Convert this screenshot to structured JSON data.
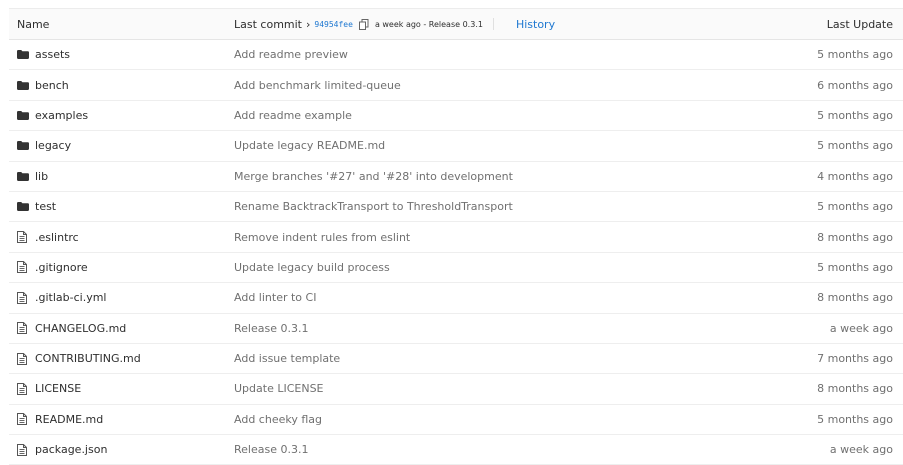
{
  "header": {
    "name_label": "Name",
    "last_commit_label": "Last commit",
    "commit_sha": "94954fee",
    "commit_time": "a week ago - Release 0.3.1",
    "history_label": "History",
    "last_update_label": "Last Update"
  },
  "rows": [
    {
      "type": "folder",
      "icon": "folder-icon",
      "name": "assets",
      "message": "Add readme preview",
      "date": "5 months ago"
    },
    {
      "type": "folder",
      "icon": "folder-icon",
      "name": "bench",
      "message": "Add benchmark limited-queue",
      "date": "6 months ago"
    },
    {
      "type": "folder",
      "icon": "folder-icon",
      "name": "examples",
      "message": "Add readme example",
      "date": "5 months ago"
    },
    {
      "type": "folder",
      "icon": "folder-icon",
      "name": "legacy",
      "message": "Update legacy README.md",
      "date": "5 months ago"
    },
    {
      "type": "folder",
      "icon": "folder-icon",
      "name": "lib",
      "message": "Merge branches '#27' and '#28' into development",
      "date": "4 months ago"
    },
    {
      "type": "folder",
      "icon": "folder-icon",
      "name": "test",
      "message": "Rename BacktrackTransport to ThresholdTransport",
      "date": "5 months ago"
    },
    {
      "type": "file",
      "icon": "file-icon",
      "name": ".eslintrc",
      "message": "Remove indent rules from eslint",
      "date": "8 months ago"
    },
    {
      "type": "file",
      "icon": "file-icon",
      "name": ".gitignore",
      "message": "Update legacy build process",
      "date": "5 months ago"
    },
    {
      "type": "file",
      "icon": "file-icon",
      "name": ".gitlab-ci.yml",
      "message": "Add linter to CI",
      "date": "8 months ago"
    },
    {
      "type": "file",
      "icon": "file-icon",
      "name": "CHANGELOG.md",
      "message": "Release 0.3.1",
      "date": "a week ago"
    },
    {
      "type": "file",
      "icon": "file-icon",
      "name": "CONTRIBUTING.md",
      "message": "Add issue template",
      "date": "7 months ago"
    },
    {
      "type": "file",
      "icon": "file-icon",
      "name": "LICENSE",
      "message": "Update LICENSE",
      "date": "8 months ago"
    },
    {
      "type": "file",
      "icon": "file-icon",
      "name": "README.md",
      "message": "Add cheeky flag",
      "date": "5 months ago"
    },
    {
      "type": "file",
      "icon": "file-icon",
      "name": "package.json",
      "message": "Release 0.3.1",
      "date": "a week ago"
    }
  ]
}
